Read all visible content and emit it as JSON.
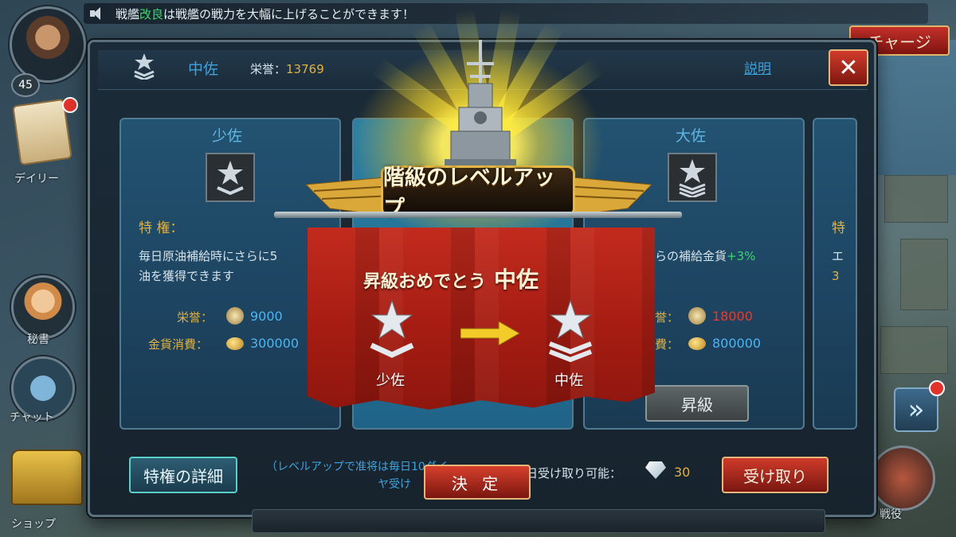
{
  "notice": {
    "prefix": "戦艦",
    "highlight": "改良",
    "suffix": "は戦艦の戦力を大幅に上げることができます！"
  },
  "charge_label": "チャージ",
  "player": {
    "level": "45"
  },
  "side_menu": {
    "daily": "デイリー",
    "secretary": "秘書",
    "chat": "チャット",
    "shop": "ショップ",
    "battle": "戦役"
  },
  "header": {
    "rank": "中佐",
    "honor_label": "栄誉：",
    "honor_value": "13769",
    "explain": "説明"
  },
  "cards": {
    "left": {
      "title": "少佐",
      "privilege_label": "特 権：",
      "desc_line1": "毎日原油補給時にさらに5",
      "desc_line2": "油を獲得できます",
      "honor_label": "栄誉：",
      "honor_value": "9000",
      "gold_label": "金貨消費：",
      "gold_value": "300000"
    },
    "right": {
      "title": "大佐",
      "desc_line1": "らの補給金貨",
      "desc_pct": "+3%",
      "honor_label": "誉：",
      "honor_value": "18000",
      "gold_label": "費：",
      "gold_value": "800000",
      "promote": "昇級"
    },
    "far_right": {
      "priv_char": "特",
      "desc1": "エ",
      "desc2": "3"
    }
  },
  "footer": {
    "privilege_detail": "特権の詳細",
    "note1": "（レベルアップで准将は毎日10ダイ",
    "note2": "ヤ受け",
    "daily_label": "日受け取り可能：",
    "daily_value": "30",
    "receive": "受け取り"
  },
  "popup": {
    "title": "階級のレベルアップ",
    "congrats": "昇級おめでとう",
    "new_rank": "中佐",
    "from_rank": "少佐",
    "to_rank": "中佐",
    "confirm": "決 定"
  },
  "colors": {
    "accent_blue": "#3fa3dd",
    "gold": "#e2b13d",
    "red": "#c22b1d",
    "green": "#3bd66b"
  }
}
